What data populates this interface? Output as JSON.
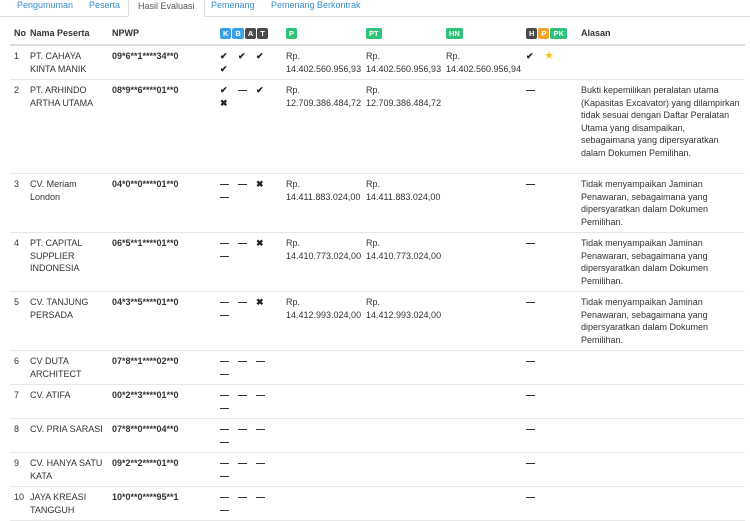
{
  "tabs": [
    "Pengumuman",
    "Peserta",
    "Hasil Evaluasi",
    "Pemenang",
    "Pemenang Berkontrak"
  ],
  "columns": {
    "no": "No",
    "nama": "Nama Peserta",
    "npwp": "NPWP",
    "badges_kbat": [
      "K",
      "B",
      "A",
      "T"
    ],
    "p": "P",
    "pt": "PT",
    "hn": "HN",
    "badges_hppk": [
      "H",
      "P",
      "PK"
    ],
    "alasan": "Alasan"
  },
  "marks": {
    "check": "✔",
    "dash": "—",
    "cross": "✖",
    "star": "★"
  },
  "rows": [
    {
      "no": "1",
      "nama": "PT. CAHAYA KINTA MANIK",
      "npwp": "09*6**1****34**0",
      "k": "✔",
      "b": "✔",
      "a": "✔",
      "t": "✔",
      "p": "Rp. 14.402.560.956,93",
      "pt": "Rp. 14.402.560.956,93",
      "hn": "Rp. 14.402.560.956,94",
      "h": "✔",
      "pk": "★",
      "alasan": ""
    },
    {
      "no": "2",
      "nama": "PT. ARHINDO ARTHA UTAMA",
      "npwp": "08*9**6****01**0",
      "k": "✔",
      "b": "—",
      "a": "✔",
      "t": "✖",
      "p": "Rp. 12.709.386.484,72",
      "pt": "Rp. 12.709.386.484,72",
      "hn": "",
      "h": "—",
      "pk": "",
      "alasan": "Bukti kepemilikan peralatan utama (Kapasitas Excavator) yang dilampirkan tidak sesuai dengan Daftar Peralatan Utama yang disampaikan, sebagaimana yang dipersyaratkan dalam Dokumen Pemilihan."
    },
    {
      "no": "3",
      "nama": "CV. Meriam London",
      "npwp": "04*0**0****01**0",
      "k": "—",
      "b": "—",
      "a": "✖",
      "t": "—",
      "p": "Rp. 14.411.883.024,00",
      "pt": "Rp. 14.411.883.024,00",
      "hn": "",
      "h": "—",
      "pk": "",
      "alasan": "Tidak menyampaikan Jaminan Penawaran, sebagaimana yang dipersyaratkan dalam Dokumen Pemilihan."
    },
    {
      "no": "4",
      "nama": "PT. CAPITAL SUPPLIER INDONESIA",
      "npwp": "06*5**1****01**0",
      "k": "—",
      "b": "—",
      "a": "✖",
      "t": "—",
      "p": "Rp. 14.410.773.024,00",
      "pt": "Rp. 14.410.773.024,00",
      "hn": "",
      "h": "—",
      "pk": "",
      "alasan": "Tidak menyampaikan Jaminan Penawaran, sebagaimana yang dipersyaratkan dalam Dokumen Pemilihan."
    },
    {
      "no": "5",
      "nama": "CV. TANJUNG PERSADA",
      "npwp": "04*3**5****01**0",
      "k": "—",
      "b": "—",
      "a": "✖",
      "t": "—",
      "p": "Rp. 14.412.993.024,00",
      "pt": "Rp. 14.412.993.024,00",
      "hn": "",
      "h": "—",
      "pk": "",
      "alasan": "Tidak menyampaikan Jaminan Penawaran, sebagaimana yang dipersyaratkan dalam Dokumen Pemilihan."
    },
    {
      "no": "6",
      "nama": "CV DUTA ARCHITECT",
      "npwp": "07*8**1****02**0",
      "k": "—",
      "b": "—",
      "a": "—",
      "t": "—",
      "p": "",
      "pt": "",
      "hn": "",
      "h": "—",
      "pk": "",
      "alasan": ""
    },
    {
      "no": "7",
      "nama": "CV. ATIFA",
      "npwp": "00*2**3****01**0",
      "k": "—",
      "b": "—",
      "a": "—",
      "t": "—",
      "p": "",
      "pt": "",
      "hn": "",
      "h": "—",
      "pk": "",
      "alasan": ""
    },
    {
      "no": "8",
      "nama": "CV. PRIA SARASI",
      "npwp": "07*8**0****04**0",
      "k": "—",
      "b": "—",
      "a": "—",
      "t": "—",
      "p": "",
      "pt": "",
      "hn": "",
      "h": "—",
      "pk": "",
      "alasan": ""
    },
    {
      "no": "9",
      "nama": "CV. HANYA SATU KATA",
      "npwp": "09*2**2****01**0",
      "k": "—",
      "b": "—",
      "a": "—",
      "t": "—",
      "p": "",
      "pt": "",
      "hn": "",
      "h": "—",
      "pk": "",
      "alasan": ""
    },
    {
      "no": "10",
      "nama": "JAYA KREASI TANGGUH",
      "npwp": "10*0**0****95**1",
      "k": "—",
      "b": "—",
      "a": "—",
      "t": "—",
      "p": "",
      "pt": "",
      "hn": "",
      "h": "—",
      "pk": "",
      "alasan": ""
    }
  ]
}
